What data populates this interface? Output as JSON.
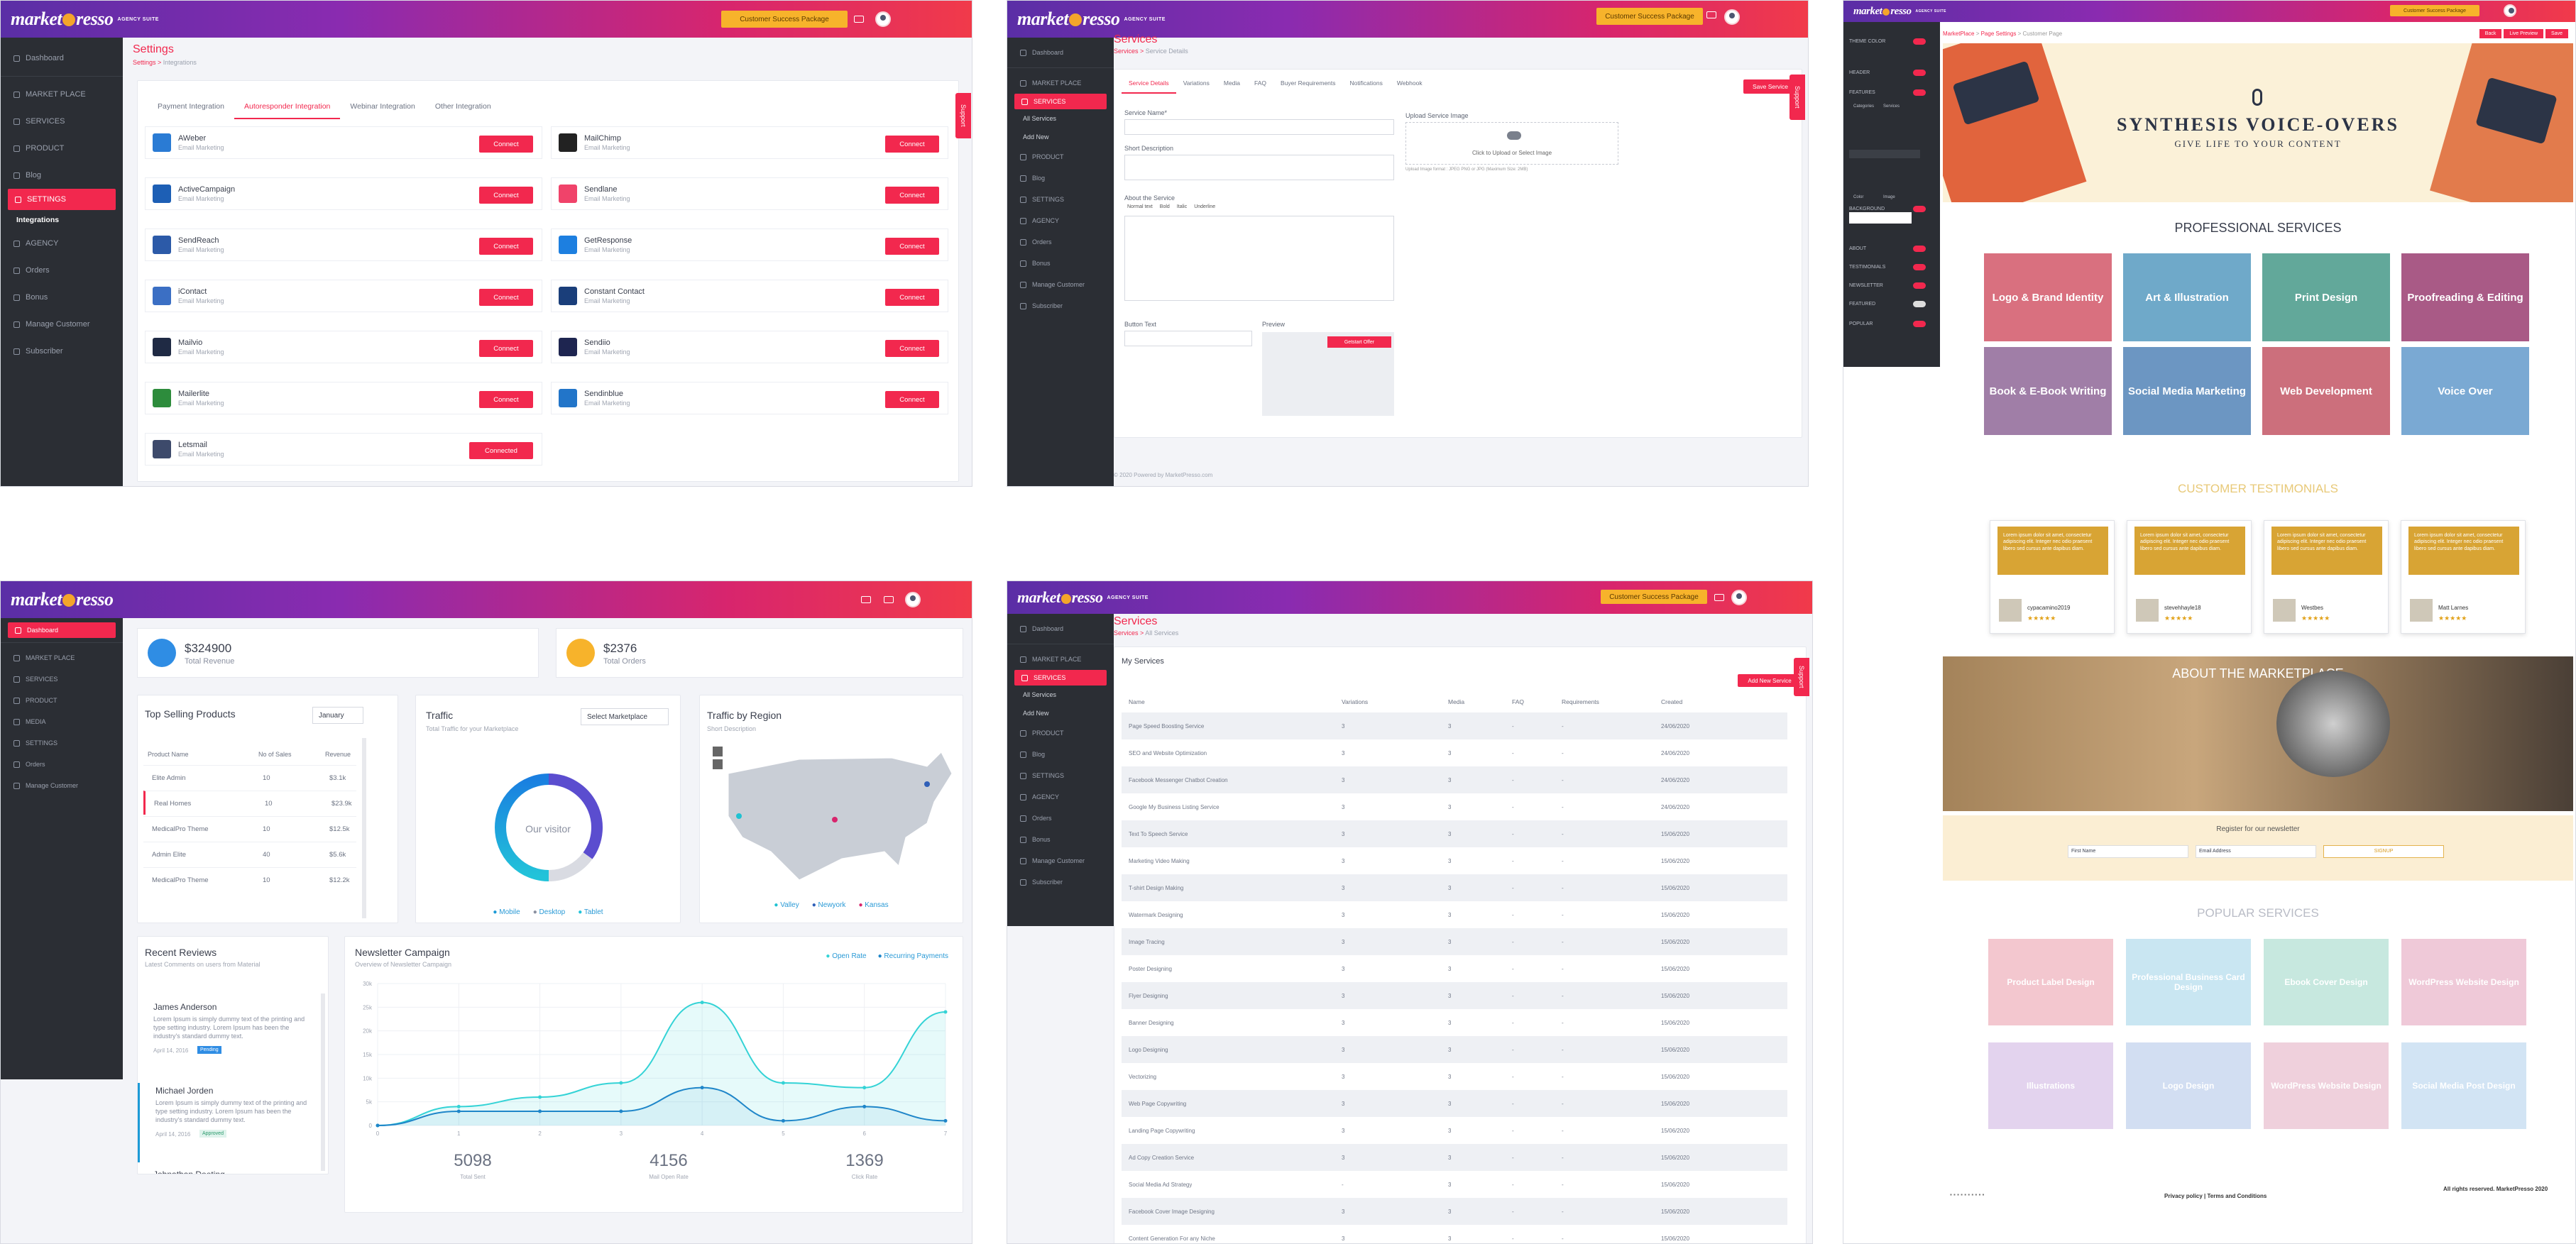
{
  "brand": {
    "logo": "market",
    "logo2": "resso",
    "suite": "AGENCY SUITE",
    "package_button": "Customer Success Package",
    "support": "Support"
  },
  "p1": {
    "sidebar": [
      {
        "label": "Dashboard",
        "icon": "dashboard-icon"
      },
      {
        "label": "MARKET PLACE",
        "icon": "marketplace-icon"
      },
      {
        "label": "SERVICES",
        "icon": "services-icon"
      },
      {
        "label": "PRODUCT",
        "icon": "product-icon"
      },
      {
        "label": "Blog",
        "icon": "blog-icon"
      },
      {
        "label": "SETTINGS",
        "icon": "settings-icon"
      },
      {
        "label": "Integrations",
        "icon": ""
      },
      {
        "label": "AGENCY",
        "icon": "agency-icon"
      },
      {
        "label": "Orders",
        "icon": "orders-icon"
      },
      {
        "label": "Bonus",
        "icon": "bonus-icon"
      },
      {
        "label": "Manage Customer",
        "icon": "customer-icon"
      },
      {
        "label": "Subscriber",
        "icon": "subscriber-icon"
      }
    ],
    "title": "Settings",
    "crumb_home": "Settings",
    "crumb_page": "Integrations",
    "tabs": [
      "Payment Integration",
      "Autoresponder Integration",
      "Webinar Integration",
      "Other Integration"
    ],
    "left": [
      {
        "name": "AWeber",
        "desc": "Email Marketing",
        "btn": "Connect",
        "color": "#2a7bd4"
      },
      {
        "name": "ActiveCampaign",
        "desc": "Email Marketing",
        "btn": "Connect",
        "color": "#1d5fb5"
      },
      {
        "name": "SendReach",
        "desc": "Email Marketing",
        "btn": "Connect",
        "color": "#2c5aa8"
      },
      {
        "name": "iContact",
        "desc": "Email Marketing",
        "btn": "Connect",
        "color": "#3b6fc4"
      },
      {
        "name": "Mailvio",
        "desc": "Email Marketing",
        "btn": "Connect",
        "color": "#1f2a44"
      },
      {
        "name": "Mailerlite",
        "desc": "Email Marketing",
        "btn": "Connect",
        "color": "#2d8c3c"
      },
      {
        "name": "Letsmail",
        "desc": "Email Marketing",
        "btn": "Connected",
        "color": "#3d4a6b"
      }
    ],
    "right": [
      {
        "name": "MailChimp",
        "desc": "Email Marketing",
        "btn": "Connect",
        "color": "#222"
      },
      {
        "name": "Sendlane",
        "desc": "Email Marketing",
        "btn": "Connect",
        "color": "#f0436a"
      },
      {
        "name": "GetResponse",
        "desc": "Email Marketing",
        "btn": "Connect",
        "color": "#1d7fe0"
      },
      {
        "name": "Constant Contact",
        "desc": "Email Marketing",
        "btn": "Connect",
        "color": "#1a3e7a"
      },
      {
        "name": "Sendiio",
        "desc": "Email Marketing",
        "btn": "Connect",
        "color": "#1e2550"
      },
      {
        "name": "Sendinblue",
        "desc": "Email Marketing",
        "btn": "Connect",
        "color": "#2275c9"
      }
    ]
  },
  "p2": {
    "sidebar": [
      "Dashboard",
      "MARKET PLACE",
      "SERVICES",
      "All Services",
      "Add New",
      "PRODUCT",
      "Blog",
      "SETTINGS",
      "AGENCY",
      "Orders",
      "Bonus",
      "Manage Customer",
      "Subscriber"
    ],
    "title": "Services",
    "crumb_home": "Services",
    "crumb_page": "Service Details",
    "tabs": [
      "Service Details",
      "Variations",
      "Media",
      "FAQ",
      "Buyer Requirements",
      "Notifications",
      "Webhook"
    ],
    "save": "Save Service",
    "labels": {
      "name": "Service Name*",
      "short": "Short Description",
      "about": "About the Service",
      "button": "Button Text",
      "preview": "Preview",
      "upload": "Upload Service Image",
      "upload_hint": "Click to Upload or Select Image",
      "upload_note": "Upload Image format : JPEG PNG or JPG (Maximum Size: 2MB)"
    },
    "editor_tools": [
      "Normal text",
      "Bold",
      "Italic",
      "Underline"
    ],
    "preview_btn": "Getstart Offer",
    "footer": "© 2020 Powered by MarketPresso.com"
  },
  "p3": {
    "crumb": [
      "MarketPlace",
      "Page Settings",
      "Customer Page"
    ],
    "top_buttons": [
      "Back",
      "Live Preview",
      "Save"
    ],
    "settings": [
      "THEME COLOR",
      "HEADER",
      "FEATURES",
      "BACKGROUND",
      "ABOUT",
      "TESTIMONIALS",
      "NEWSLETTER",
      "FEATURED",
      "POPULAR"
    ],
    "settings_opts": [
      "Categories",
      "Services",
      "Color",
      "Image"
    ],
    "heading_img": "SYNTHESIS VOICE-OVERS",
    "heading_sub": "GIVE LIFE TO YOUR CONTENT",
    "pro": "PROFESSIONAL SERVICES",
    "tiles": [
      {
        "label": "Logo & Brand Identity",
        "color": "#d9707f"
      },
      {
        "label": "Art & Illustration",
        "color": "#6fa9c9"
      },
      {
        "label": "Print Design",
        "color": "#62a89a"
      },
      {
        "label": "Proofreading & Editing",
        "color": "#a95a86"
      },
      {
        "label": "Book & E-Book Writing",
        "color": "#a07ea7"
      },
      {
        "label": "Social Media Marketing",
        "color": "#6c96c2"
      },
      {
        "label": "Web Development",
        "color": "#cc6f7c"
      },
      {
        "label": "Voice Over",
        "color": "#7aa9d3"
      }
    ],
    "testimonials_title": "CUSTOMER TESTIMONIALS",
    "testimonials": [
      {
        "name": "cypacamino2019",
        "stars": "★★★★★"
      },
      {
        "name": "stevehhayle18",
        "stars": "★★★★★"
      },
      {
        "name": "Westbes",
        "stars": "★★★★★"
      },
      {
        "name": "Matt Larnes",
        "stars": "★★★★★"
      }
    ],
    "testi_text": "Lorem ipsum dolor sit amet, consectetur adipiscing elit. Integer nec odio praesent libero sed cursus ante dapibus diam.",
    "about": "ABOUT THE MARKETPLACE",
    "newsletter": "Register for our newsletter",
    "nl_fields": [
      "First Name",
      "Email Address"
    ],
    "nl_btn": "SIGNUP",
    "popular": "POPULAR SERVICES",
    "popular_tiles": [
      {
        "label": "Product Label Design",
        "color": "#f3c7cf"
      },
      {
        "label": "Professional Business Card Design",
        "color": "#c9e6f2"
      },
      {
        "label": "Ebook Cover Design",
        "color": "#c7e8df"
      },
      {
        "label": "WordPress Website Design",
        "color": "#efc9d8"
      },
      {
        "label": "Illustrations",
        "color": "#e3d3ee"
      },
      {
        "label": "Logo Design",
        "color": "#d2def2"
      },
      {
        "label": "WordPress Website Design",
        "color": "#efd0dc"
      },
      {
        "label": "Social Media Post Design",
        "color": "#d2e4f4"
      }
    ],
    "footer_left": "Privacy policy | Terms and Conditions",
    "footer_right": "All rights reserved. MarketPresso 2020"
  },
  "p4": {
    "sidebar": [
      "Dashboard",
      "MARKET PLACE",
      "SERVICES",
      "PRODUCT",
      "MEDIA",
      "SETTINGS",
      "Orders",
      "Manage Customer"
    ],
    "revenue": "$324900",
    "revenue_label": "Total Revenue",
    "orders": "$2376",
    "orders_label": "Total Orders",
    "tsp_title": "Top Selling Products",
    "tsp_select": "January",
    "tsp_head": [
      "Product Name",
      "No of Sales",
      "Revenue"
    ],
    "tsp_rows": [
      [
        "Elite Admin",
        "10",
        "$3.1k"
      ],
      [
        "Real Homes",
        "10",
        "$23.9k"
      ],
      [
        "MedicalPro Theme",
        "10",
        "$12.5k"
      ],
      [
        "Admin Elite",
        "40",
        "$5.6k"
      ],
      [
        "MedicalPro Theme",
        "10",
        "$12.2k"
      ]
    ],
    "traffic_title": "Traffic",
    "traffic_sub": "Total Traffic for your Marketplace",
    "traffic_select": "Select Marketplace",
    "donut_center": "Our visitor",
    "traffic_legend": [
      "Mobile",
      "Desktop",
      "Tablet"
    ],
    "region_title": "Traffic by Region",
    "region_sub": "Short Description",
    "region_legend": [
      "Valley",
      "Newyork",
      "Kansas"
    ],
    "reviews_title": "Recent Reviews",
    "reviews_sub": "Latest Comments on users from Material",
    "reviews": [
      {
        "name": "James Anderson",
        "text": "Lorem Ipsum is simply dummy text of the printing and type setting industry. Lorem Ipsum has been the industry's standard dummy text.",
        "date": "April 14, 2016",
        "badge": "Pending",
        "badge_color": "#2f8de4"
      },
      {
        "name": "Michael Jorden",
        "text": "Lorem Ipsum is simply dummy text of the printing and type setting industry. Lorem Ipsum has been the industry's standard dummy text.",
        "date": "April 14, 2016",
        "badge": "Approved",
        "badge_color": "#dff3ec"
      },
      {
        "name": "Johnathan Doeting",
        "text": "",
        "date": "",
        "badge": "",
        "badge_color": "#fff"
      }
    ],
    "news_title": "Newsletter Campaign",
    "news_sub": "Overview of Newsletter Campaign",
    "news_legend": [
      "Open Rate",
      "Recurring Payments"
    ],
    "stats": [
      {
        "v": "5098",
        "l": "Total Sent"
      },
      {
        "v": "4156",
        "l": "Mail Open Rate"
      },
      {
        "v": "1369",
        "l": "Click Rate"
      }
    ]
  },
  "chart_data": [
    {
      "type": "line",
      "title": "Newsletter Campaign",
      "x": [
        0,
        1,
        2,
        3,
        4,
        5,
        6,
        7
      ],
      "ylim": [
        0,
        30
      ],
      "yticks": [
        "0",
        "5k",
        "10k",
        "15k",
        "20k",
        "25k",
        "30k"
      ],
      "series": [
        {
          "name": "Open Rate",
          "values": [
            0,
            4,
            6,
            9,
            26,
            9,
            8,
            24
          ]
        },
        {
          "name": "Recurring Payments",
          "values": [
            0,
            3,
            3,
            3,
            8,
            1,
            4,
            1
          ]
        }
      ]
    },
    {
      "type": "pie",
      "title": "Traffic",
      "categories": [
        "Mobile",
        "Desktop",
        "Tablet"
      ],
      "values": [
        35,
        15,
        50
      ]
    }
  ],
  "p5": {
    "sidebar": [
      "Dashboard",
      "MARKET PLACE",
      "SERVICES",
      "All Services",
      "Add New",
      "PRODUCT",
      "Blog",
      "SETTINGS",
      "AGENCY",
      "Orders",
      "Bonus",
      "Manage Customer",
      "Subscriber"
    ],
    "title": "Services",
    "crumb_home": "Services",
    "crumb_page": "All Services",
    "section": "My Services",
    "add_btn": "Add New Service",
    "head": [
      "Name",
      "Variations",
      "Media",
      "FAQ",
      "Requirements",
      "Created"
    ],
    "rows": [
      [
        "Page Speed Boosting Service",
        "3",
        "3",
        "-",
        "-",
        "24/06/2020"
      ],
      [
        "SEO and Website Optimization",
        "3",
        "3",
        "-",
        "-",
        "24/06/2020"
      ],
      [
        "Facebook Messenger Chatbot Creation",
        "3",
        "3",
        "-",
        "-",
        "24/06/2020"
      ],
      [
        "Google My Business Listing Service",
        "3",
        "3",
        "-",
        "-",
        "24/06/2020"
      ],
      [
        "Text To Speech Service",
        "3",
        "3",
        "-",
        "-",
        "15/06/2020"
      ],
      [
        "Marketing Video Making",
        "3",
        "3",
        "-",
        "-",
        "15/06/2020"
      ],
      [
        "T-shirt Design Making",
        "3",
        "3",
        "-",
        "-",
        "15/06/2020"
      ],
      [
        "Watermark Designing",
        "3",
        "3",
        "-",
        "-",
        "15/06/2020"
      ],
      [
        "Image Tracing",
        "3",
        "3",
        "-",
        "-",
        "15/06/2020"
      ],
      [
        "Poster Designing",
        "3",
        "3",
        "-",
        "-",
        "15/06/2020"
      ],
      [
        "Flyer Designing",
        "3",
        "3",
        "-",
        "-",
        "15/06/2020"
      ],
      [
        "Banner Designing",
        "3",
        "3",
        "-",
        "-",
        "15/06/2020"
      ],
      [
        "Logo Designing",
        "3",
        "3",
        "-",
        "-",
        "15/06/2020"
      ],
      [
        "Vectorizing",
        "3",
        "3",
        "-",
        "-",
        "15/06/2020"
      ],
      [
        "Web Page Copywriting",
        "3",
        "3",
        "-",
        "-",
        "15/06/2020"
      ],
      [
        "Landing Page Copywriting",
        "3",
        "3",
        "-",
        "-",
        "15/06/2020"
      ],
      [
        "Ad Copy Creation Service",
        "3",
        "3",
        "-",
        "-",
        "15/06/2020"
      ],
      [
        "Social Media Ad Strategy",
        "-",
        "3",
        "-",
        "-",
        "15/06/2020"
      ],
      [
        "Facebook Cover Image Designing",
        "3",
        "3",
        "-",
        "-",
        "15/06/2020"
      ],
      [
        "Content Generation For any Niche",
        "3",
        "3",
        "-",
        "-",
        "15/06/2020"
      ]
    ]
  }
}
